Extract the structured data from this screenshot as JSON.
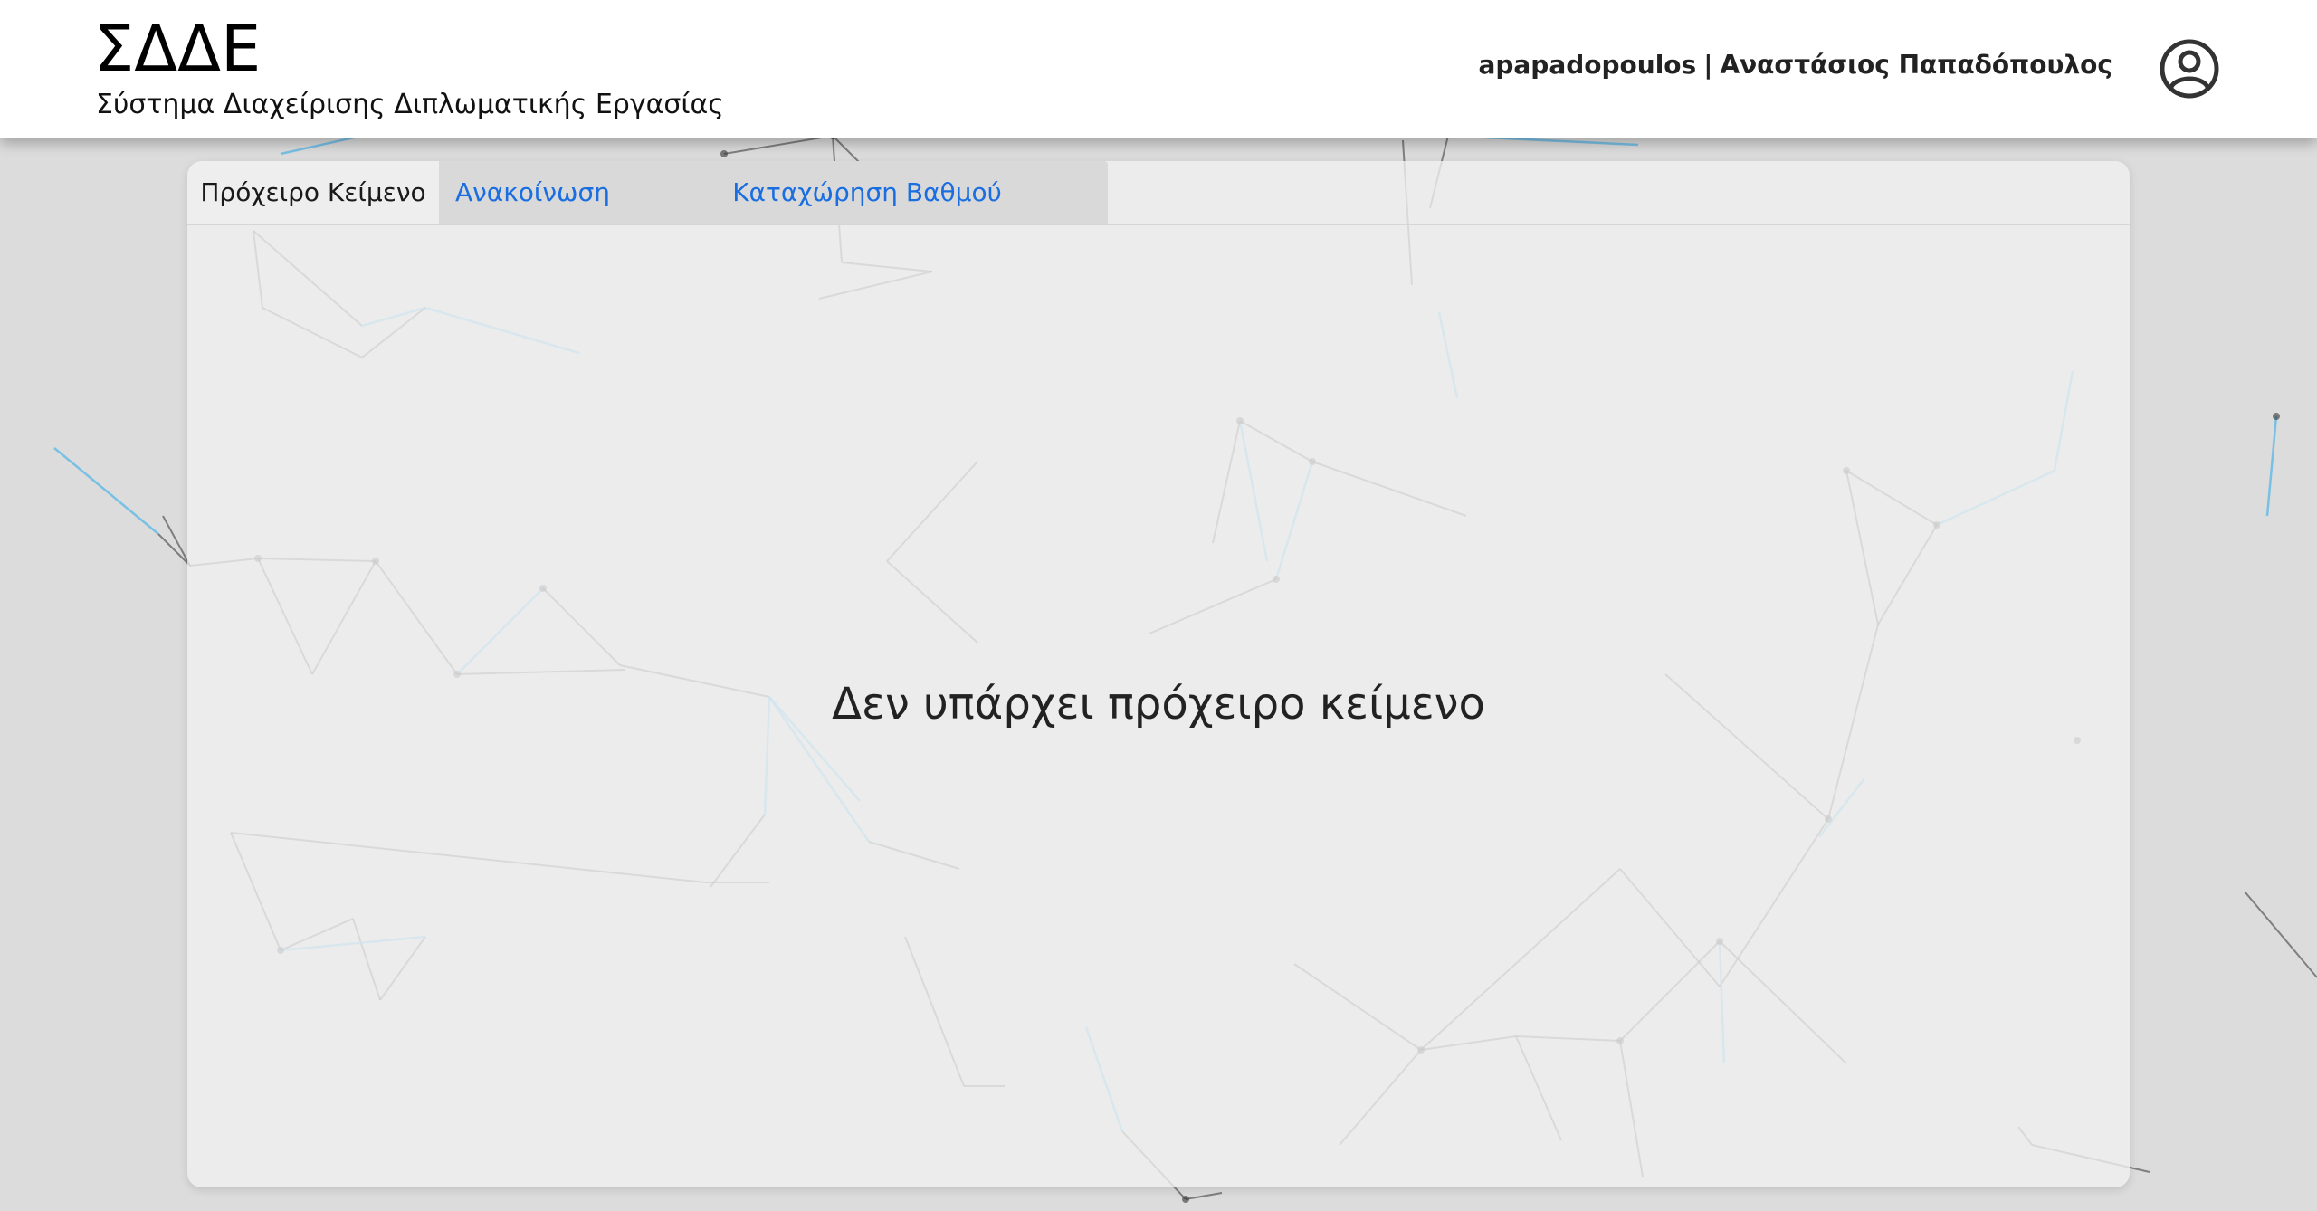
{
  "header": {
    "app_title": "ΣΔΔΕ",
    "app_subtitle": "Σύστημα Διαχείρισης Διπλωματικής Εργασίας",
    "username": "apapadopoulos",
    "separator": "|",
    "full_name": "Αναστάσιος Παπαδόπουλος",
    "avatar_icon": "user-circle-icon"
  },
  "tabs": [
    {
      "label": "Πρόχειρο Κείμενο",
      "active": true
    },
    {
      "label": "Ανακοίνωση",
      "active": false
    },
    {
      "label": "Καταχώρηση Βαθμού",
      "active": false
    }
  ],
  "main": {
    "empty_message": "Δεν υπάρχει πρόχειρο κείμενο"
  },
  "colors": {
    "link": "#1a6ee0",
    "background": "#dcdcdc",
    "header_bg": "#ffffff",
    "network_dark": "#333333",
    "network_blue": "#4fb3e8"
  }
}
